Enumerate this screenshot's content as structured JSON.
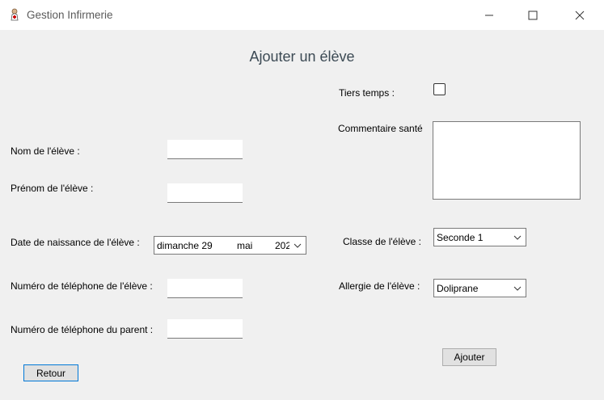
{
  "window": {
    "title": "Gestion Infirmerie",
    "icons": [
      "app-nurse-icon",
      "minimize-icon",
      "maximize-icon",
      "close-icon"
    ]
  },
  "form": {
    "heading": "Ajouter un élève",
    "tiers_temps_label": "Tiers temps :",
    "tiers_temps_checked": false,
    "commentaire_label": "Commentaire santé",
    "commentaire_value": "",
    "nom_label": "Nom de l'élève :",
    "nom_value": "",
    "prenom_label": "Prénom de l'élève :",
    "prenom_value": "",
    "date_label": "Date de naissance de l'élève :",
    "date_day": "dimanche 29",
    "date_month": "mai",
    "date_year": "202",
    "classe_label": "Classe de l'élève :",
    "classe_value": "Seconde 1",
    "tel_eleve_label": "Numéro de téléphone de l'élève :",
    "tel_eleve_value": "",
    "allergie_label": "Allergie de l'élève :",
    "allergie_value": "Doliprane",
    "tel_parent_label": "Numéro de téléphone du parent :",
    "tel_parent_value": "",
    "ajouter_button": "Ajouter",
    "retour_button": "Retour"
  }
}
